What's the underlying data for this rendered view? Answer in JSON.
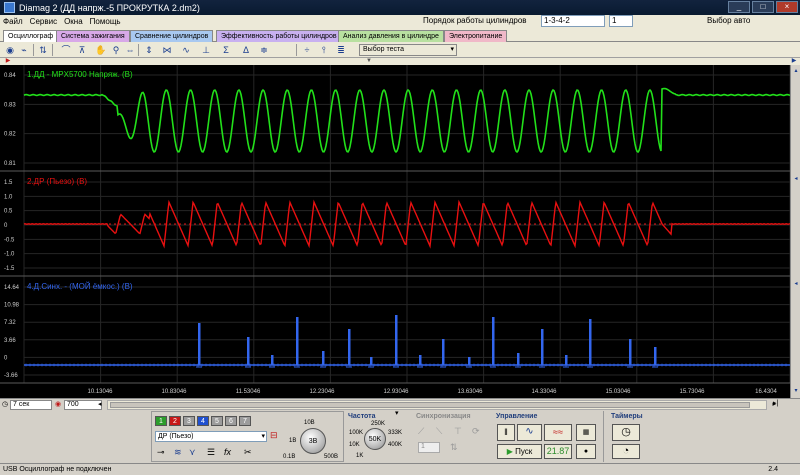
{
  "window": {
    "title": "Diamag 2 (ДД напрж.-5 ПРОКРУТКА 2.dm2)",
    "controls": [
      "_",
      "□",
      "×"
    ]
  },
  "menu": {
    "items": [
      "Файл",
      "Сервис",
      "Окна",
      "Помощь"
    ],
    "cylinder_order_label": "Порядок работы цилиндров",
    "cylinder_order_value": "1-3-4-2",
    "cylinder_spin_value": "1",
    "auto_select_label": "Выбор авто"
  },
  "tabs": [
    {
      "label": "Осциллограф",
      "color": "#ece9d8",
      "active": true
    },
    {
      "label": "Система зажигания",
      "color": "#d8a8e8"
    },
    {
      "label": "Сравнение цилиндров",
      "color": "#a8c8f0"
    },
    {
      "label": "Эффективность работы цилиндров",
      "color": "#c8b0f0"
    },
    {
      "label": "Анализ давления в цилиндре",
      "color": "#b8e0a0"
    },
    {
      "label": "Электропитание",
      "color": "#f0b8c8"
    }
  ],
  "toolbar": {
    "test_select": "Выбор теста",
    "icons": [
      "oscilloscope-icon",
      "ignition-icon",
      "compare-icon",
      "hand-icon",
      "zoom-icon",
      "scale-x-icon",
      "scale-y-icon",
      "overlay-icon",
      "frequency-icon",
      "cursor-icon",
      "sigma-icon",
      "math-icon",
      "delta-icon"
    ]
  },
  "scope": {
    "colors": {
      "green": "#22e01a",
      "red": "#e81010",
      "blue": "#3366ee",
      "grid": "#2a2a2a",
      "axis": "#cfcfcf",
      "background": "#000000"
    },
    "markers": [
      "1",
      "2",
      "3"
    ],
    "channels": [
      {
        "label": "1.ДД - MPX5700 Напряж. (В)",
        "color": "#22e01a",
        "yticks": [
          "0.84",
          "0.83",
          "0.82",
          "0.81"
        ]
      },
      {
        "label": "2.ДР (Пьезо) (В)",
        "color": "#e81010",
        "yticks": [
          "1.5",
          "1.0",
          "0.5",
          "0",
          "-0.5",
          "-1.0",
          "-1.5"
        ]
      },
      {
        "label": "4.Д.Синх. - (МОЙ ёмкос.) (В)",
        "color": "#3366ee",
        "yticks": [
          "14.64",
          "10.98",
          "7.32",
          "3.66",
          "0",
          "-3.66"
        ]
      }
    ],
    "xticks": [
      "10.13046",
      "10.83046",
      "11.53046",
      "12.23046",
      "12.93046",
      "13.63046",
      "14.33046",
      "15.03046",
      "15.73046",
      "16.4304"
    ]
  },
  "timebar": {
    "timebase": "7 сек",
    "samples": "700"
  },
  "panel": {
    "channel_buttons": [
      {
        "label": "1",
        "color": "#2c9c2c"
      },
      {
        "label": "2",
        "color": "#c81818"
      },
      {
        "label": "3",
        "color": "#9c9c9c"
      },
      {
        "label": "4",
        "color": "#2050d0"
      },
      {
        "label": "5",
        "color": "#9c9c9c"
      },
      {
        "label": "6",
        "color": "#9c9c9c"
      },
      {
        "label": "7",
        "color": "#9c9c9c"
      }
    ],
    "sensor": "ДР (Пьезо)",
    "volt_knob": {
      "value": "3В",
      "labels": [
        "10В",
        "1В",
        "0.1В",
        "500В"
      ]
    },
    "frequency": {
      "title": "Частота",
      "value": "50K",
      "labels": [
        "250K",
        "100K",
        "333K",
        "10K",
        "400K",
        "1K"
      ]
    },
    "sync": {
      "title": "Синхронизация",
      "value": "1"
    },
    "control": {
      "title": "Управление",
      "start": "Пуск",
      "counter": "21.87"
    },
    "timers": {
      "title": "Таймеры"
    }
  },
  "status": {
    "text": "USB Осциллограф не подключен",
    "version": "2.4"
  }
}
